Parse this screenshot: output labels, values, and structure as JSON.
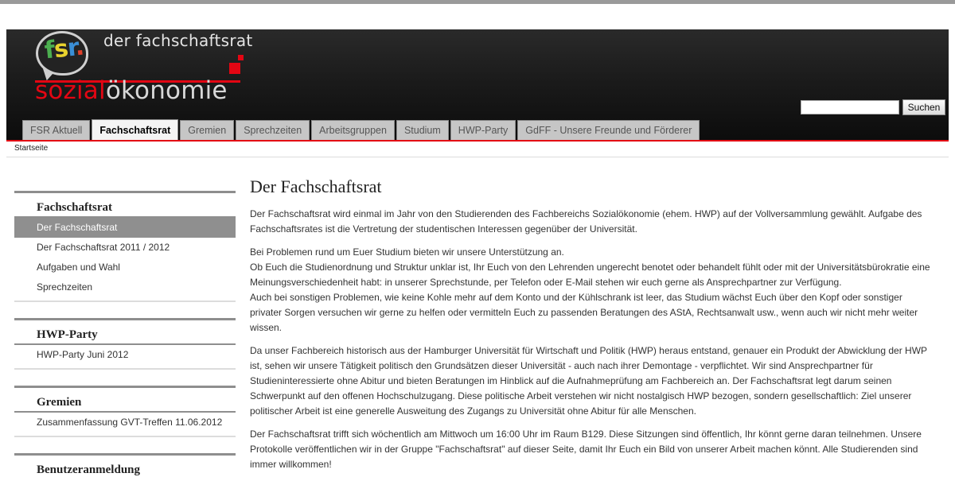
{
  "logo": {
    "fsr_f": "f",
    "fsr_s": "s",
    "fsr_r": "r",
    "fsr_dot": ".",
    "top_text": "der fachschaftsrat",
    "bottom_red": "sozial",
    "bottom_light": "ökonomie",
    "colors": {
      "red": "#e30613",
      "green": "#4caf50",
      "yellow": "#e8d22e",
      "blue": "#3a8fd6"
    }
  },
  "search": {
    "value": "",
    "button_label": "Suchen"
  },
  "tabs": [
    {
      "label": "FSR Aktuell"
    },
    {
      "label": "Fachschaftsrat",
      "active": true
    },
    {
      "label": "Gremien"
    },
    {
      "label": "Sprechzeiten"
    },
    {
      "label": "Arbeitsgruppen"
    },
    {
      "label": "Studium"
    },
    {
      "label": "HWP-Party"
    },
    {
      "label": "GdFF - Unsere Freunde und Förderer"
    }
  ],
  "breadcrumb": "Startseite",
  "sidebar": {
    "blocks": [
      {
        "title": "Fachschaftsrat",
        "items": [
          "Der Fachschaftsrat",
          "Der Fachschaftsrat 2011 / 2012",
          "Aufgaben und Wahl",
          "Sprechzeiten"
        ]
      },
      {
        "title": "HWP-Party",
        "items": [
          "HWP-Party Juni 2012"
        ]
      },
      {
        "title": "Gremien",
        "items": [
          "Zusammenfassung GVT-Treffen 11.06.2012"
        ]
      },
      {
        "title": "Benutzeranmeldung",
        "items": []
      }
    ]
  },
  "content": {
    "title": "Der Fachschaftsrat",
    "p1": "Der Fachschaftsrat wird einmal im Jahr von den Studierenden des Fachbereichs Sozialökonomie (ehem. HWP) auf der Vollversammlung gewählt. Aufgabe des Fachschaftsrates ist die Vertretung der studentischen Interessen gegenüber der Universität.",
    "p2a": "Bei Problemen rund um Euer Studium bieten wir unsere Unterstützung an.",
    "p2b": "Ob Euch die Studienordnung und Struktur unklar ist, Ihr Euch von den Lehrenden ungerecht benotet oder behandelt fühlt oder mit der Universitätsbürokratie eine Meinungsverschiedenheit habt: in unserer Sprechstunde, per Telefon oder E-Mail stehen wir euch gerne als Ansprechpartner zur Verfügung.",
    "p2c": "Auch bei sonstigen Problemen, wie keine Kohle mehr auf dem Konto und der Kühlschrank ist leer, das Studium wächst Euch über den Kopf oder sonstiger privater Sorgen versuchen wir gerne zu helfen oder vermitteln Euch zu passenden Beratungen des AStA, Rechtsanwalt usw., wenn auch wir nicht mehr weiter wissen.",
    "p3": "Da unser Fachbereich historisch aus der Hamburger Universität für Wirtschaft und Politik (HWP) heraus entstand, genauer ein Produkt der Abwicklung der HWP ist, sehen wir unsere Tätigkeit politisch den Grundsätzen dieser Universität  - auch nach ihrer Demontage - verpflichtet.  Wir sind Ansprechpartner für Studieninteressierte ohne Abitur und bieten Beratungen im Hinblick auf die Aufnahmeprüfung am Fachbereich an. Der Fachschaftsrat legt darum seinen Schwerpunkt auf den offenen Hochschulzugang.  Diese politische Arbeit verstehen wir nicht nostalgisch HWP bezogen, sondern gesellschaftlich: Ziel unserer politischer Arbeit ist eine generelle Ausweitung des Zugangs zu Universität ohne Abitur für alle Menschen.",
    "p4": "Der Fachschaftsrat trifft sich wöchentlich am Mittwoch um 16:00 Uhr im Raum B129. Diese Sitzungen sind öffentlich, Ihr könnt gerne daran teilnehmen. Unsere Protokolle veröffentlichen wir in der Gruppe \"Fachschaftsrat\" auf dieser Seite, damit Ihr Euch ein Bild von unserer Arbeit machen könnt. Alle Studierenden sind immer willkommen!"
  }
}
